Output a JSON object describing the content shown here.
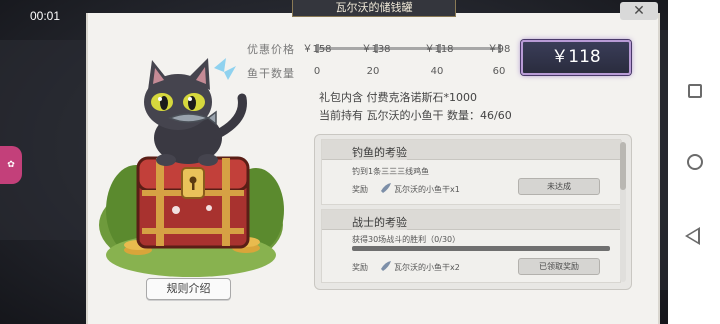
{
  "status_bar": {
    "time": "00:01"
  },
  "dialog": {
    "title": "瓦尔沃的储钱罐",
    "close_label": "✕"
  },
  "price_track": {
    "price_label": "优惠价格",
    "qty_label": "鱼干数量",
    "prices": [
      "￥158",
      "￥138",
      "￥118",
      "￥98"
    ],
    "quantities": [
      "0",
      "20",
      "40",
      "60"
    ]
  },
  "current_price": "￥118",
  "info": {
    "bundle_line": "礼包内含 付费克洛诺斯石*1000",
    "holding_line": "当前持有 瓦尔沃的小鱼干 数量：46/60"
  },
  "rules_button": "规则介绍",
  "tasks": [
    {
      "title": "钓鱼的考验",
      "desc": "钓到1条三三三线鸡鱼",
      "reward_label": "奖励",
      "reward_item": "瓦尔沃的小鱼干x1",
      "button": "未达成"
    },
    {
      "title": "战士的考验",
      "desc": "获得30场战斗的胜利（0/30）",
      "reward_label": "奖励",
      "reward_item": "瓦尔沃的小鱼干x2",
      "button": "已领取奖励",
      "progress": 0
    }
  ],
  "colors": {
    "dialog_bg": "#f3f2ef",
    "price_button_bg": "#2f3145",
    "price_button_border": "#b89bd6"
  },
  "icons": [
    "close-icon",
    "fish-icon",
    "cat-mascot",
    "treasure-chest",
    "back-icon",
    "home-icon",
    "recent-apps-icon"
  ]
}
